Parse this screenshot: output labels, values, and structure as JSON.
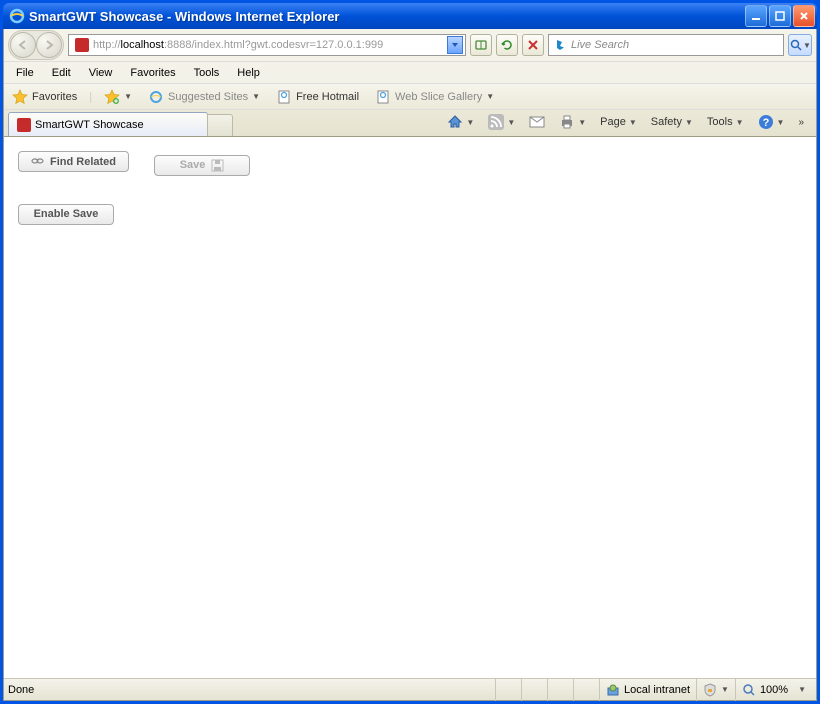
{
  "window": {
    "title": "SmartGWT Showcase - Windows Internet Explorer"
  },
  "url": {
    "prefix": "http://",
    "host": "localhost",
    "rest": ":8888/index.html?gwt.codesvr=127.0.0.1:999"
  },
  "search": {
    "placeholder": "Live Search"
  },
  "menu": {
    "file": "File",
    "edit": "Edit",
    "view": "View",
    "favorites": "Favorites",
    "tools": "Tools",
    "help": "Help"
  },
  "favbar": {
    "favorites": "Favorites",
    "suggested": "Suggested Sites",
    "hotmail": "Free Hotmail",
    "slice": "Web Slice Gallery"
  },
  "tab": {
    "title": "SmartGWT Showcase"
  },
  "tabtools": {
    "page": "Page",
    "safety": "Safety",
    "tools": "Tools"
  },
  "content": {
    "find_related": "Find Related",
    "save": "Save",
    "enable_save": "Enable Save"
  },
  "status": {
    "done": "Done",
    "zone": "Local intranet",
    "zoom": "100%"
  }
}
